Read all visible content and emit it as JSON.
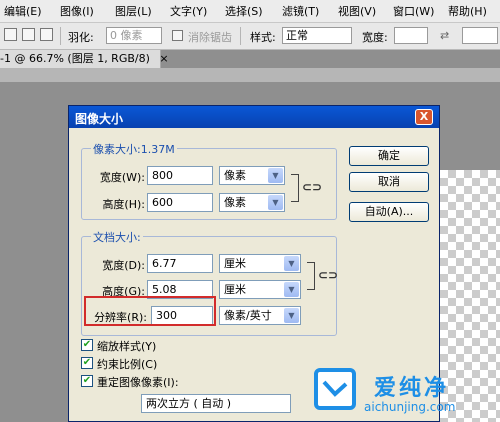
{
  "menubar": {
    "items": [
      "编辑(E)",
      "图像(I)",
      "图层(L)",
      "文字(Y)",
      "选择(S)",
      "滤镜(T)",
      "视图(V)",
      "窗口(W)",
      "帮助(H)"
    ]
  },
  "options_bar": {
    "feather_label": "羽化:",
    "feather_value": "0 像素",
    "antialias_label": "消除锯齿",
    "style_label": "样式:",
    "style_value": "正常",
    "width_label": "宽度:"
  },
  "document_tab": {
    "label": "-1 @ 66.7% (图层 1, RGB/8)",
    "close_symbol": "×"
  },
  "dialog": {
    "title": "图像大小",
    "close_symbol": "X",
    "pixel_dimensions": {
      "title": "像素大小:1.37M",
      "width_label": "宽度(W):",
      "width_value": "800",
      "width_unit": "像素",
      "height_label": "高度(H):",
      "height_value": "600",
      "height_unit": "像素"
    },
    "document_size": {
      "title": "文档大小:",
      "width_label": "宽度(D):",
      "width_value": "6.77",
      "width_unit": "厘米",
      "height_label": "高度(G):",
      "height_value": "5.08",
      "height_unit": "厘米",
      "resolution_label": "分辨率(R):",
      "resolution_value": "300",
      "resolution_unit": "像素/英寸"
    },
    "buttons": {
      "ok": "确定",
      "cancel": "取消",
      "auto": "自动(A)..."
    },
    "options": {
      "scale_styles": {
        "label": "缩放样式(Y)",
        "checked": true
      },
      "constrain_proportions": {
        "label": "约束比例(C)",
        "checked": true
      },
      "resample": {
        "label": "重定图像像素(I):",
        "checked": true
      },
      "resample_method": "两次立方 ( 自动 )"
    },
    "check_symbol": "✔",
    "dropdown_symbol": "▼"
  },
  "watermark": {
    "text": "爱纯净",
    "url": "aichunjing.com"
  },
  "colors": {
    "title_bar": "#0a58d6",
    "dialog_bg": "#ece9d8",
    "highlight_box": "#d22b2b",
    "group_title": "#1b4fae"
  }
}
